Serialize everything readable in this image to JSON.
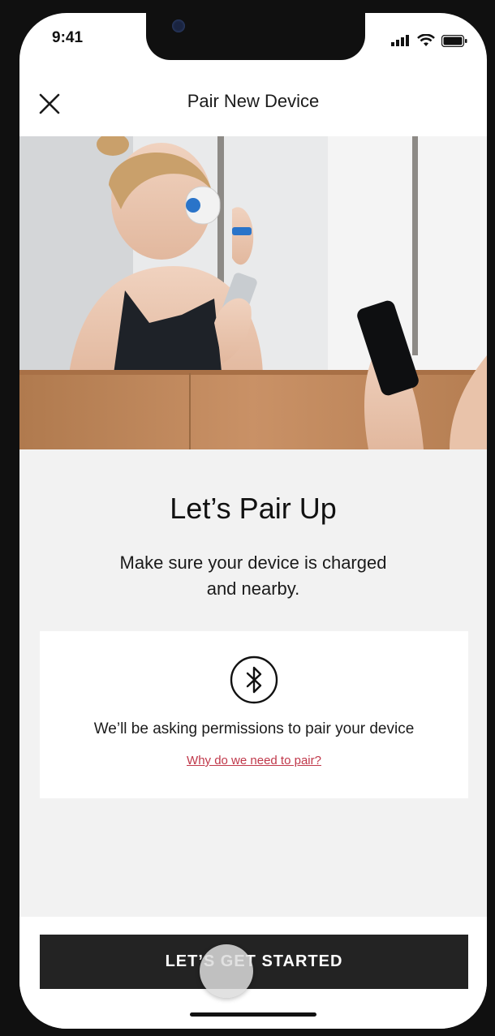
{
  "status_bar": {
    "time": "9:41"
  },
  "header": {
    "title": "Pair New Device"
  },
  "icons": {
    "close": "close-icon",
    "bluetooth": "bluetooth-icon",
    "signal": "signal-icon",
    "wifi": "wifi-icon",
    "battery": "battery-icon"
  },
  "hero": {
    "image": "woman holding skincare device and phone at bathroom mirror"
  },
  "main": {
    "title": "Let’s Pair Up",
    "subtitle": "Make sure your device is charged and nearby.",
    "permission_card": {
      "text": "We’ll be asking permissions to pair your device",
      "link": "Why do we need to pair?"
    }
  },
  "footer": {
    "cta_label": "LET’S GET STARTED"
  },
  "colors": {
    "link": "#c0384a",
    "cta_bg": "#232323",
    "content_bg": "#f2f2f2"
  }
}
